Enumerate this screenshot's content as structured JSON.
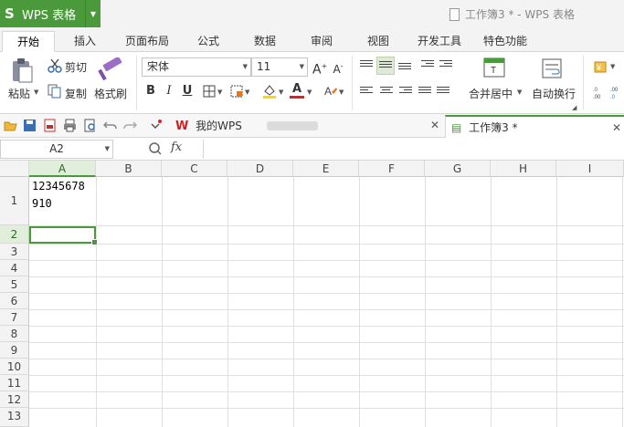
{
  "app": {
    "logo": "S",
    "name": "WPS 表格",
    "window_title": "工作簿3 * - WPS 表格"
  },
  "tabs": [
    "开始",
    "插入",
    "页面布局",
    "公式",
    "数据",
    "审阅",
    "视图",
    "开发工具",
    "特色功能"
  ],
  "ribbon": {
    "paste": "粘贴",
    "cut": "剪切",
    "copy": "复制",
    "format_painter": "格式刷",
    "font_name": "宋体",
    "font_size": "11",
    "merge_center": "合并居中",
    "wrap_text": "自动换行",
    "bold": "B",
    "italic": "I",
    "underline": "U",
    "font_color_letter": "A"
  },
  "quickbar": {
    "tab_mywps": "我的WPS",
    "tab_workbook": "工作簿3 *"
  },
  "formula": {
    "name_box": "A2",
    "fx": "fx"
  },
  "sheet": {
    "columns": [
      "A",
      "B",
      "C",
      "D",
      "E",
      "F",
      "G",
      "H",
      "I"
    ],
    "rows": [
      "1",
      "2",
      "3",
      "4",
      "5",
      "6",
      "7",
      "8",
      "9",
      "10",
      "11",
      "12",
      "13"
    ],
    "cell_a1_line1": "12345678",
    "cell_a1_line2": "910"
  },
  "colors": {
    "accent": "#4a9a3c",
    "font_color": "#e02020",
    "highlight": "#ffd800"
  }
}
